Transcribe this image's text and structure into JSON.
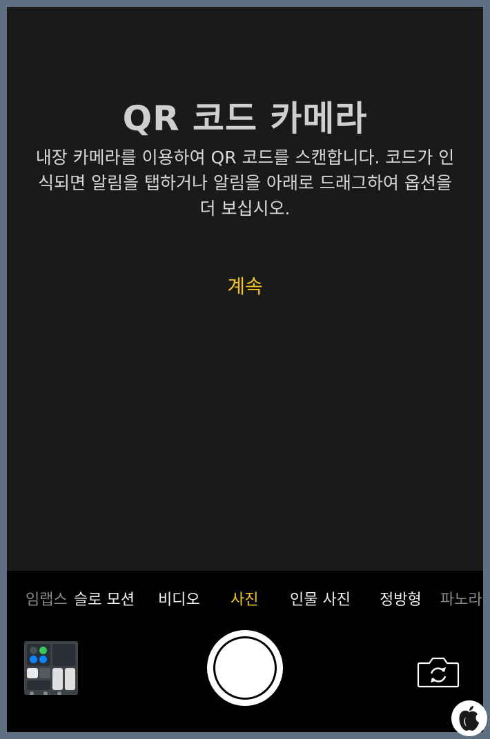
{
  "viewfinder": {
    "title": "QR 코드 카메라",
    "description": "내장 카메라를 이용하여 QR 코드를 스캔합니다. 코드가 인식되면 알림을 탭하거나 알림을 아래로 드래그하여 옵션을 더 보십시오.",
    "continue_label": "계속"
  },
  "modes": {
    "items": [
      "임랩스",
      "슬로 모션",
      "비디오",
      "사진",
      "인물 사진",
      "정방형",
      "파노라"
    ],
    "selected": "사진"
  },
  "colors": {
    "accent": "#f5c518",
    "viewfinder_bg": "#1a1a1a",
    "controls_bg": "#000000"
  },
  "icons": {
    "thumbnail": "last-photo-thumbnail",
    "shutter": "shutter-button",
    "flip": "camera-flip-icon",
    "badge": "apple-logo-icon"
  }
}
